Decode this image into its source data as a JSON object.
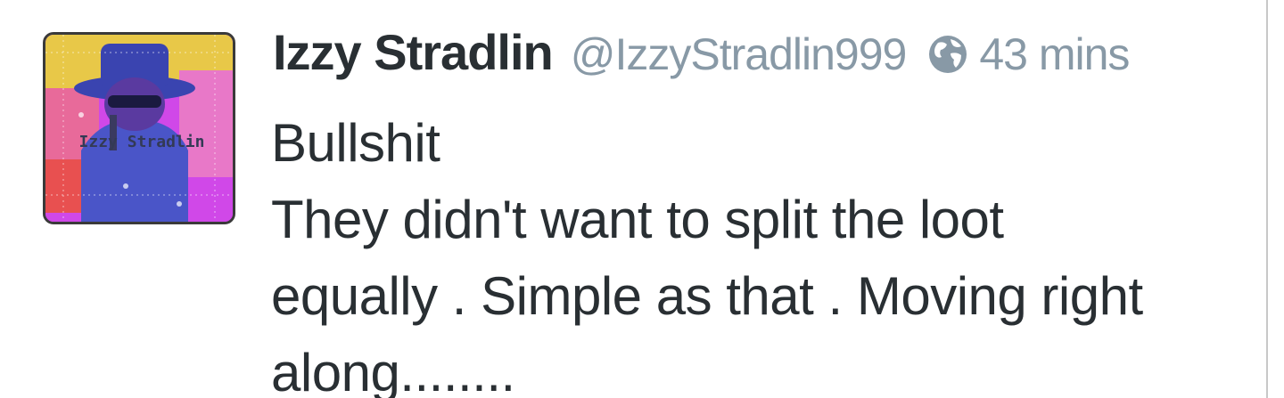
{
  "tweet": {
    "display_name": "Izzy Stradlin",
    "handle": "@IzzyStradlin999",
    "time": "43 mins",
    "privacy_icon": "globe-icon",
    "text_lines": [
      "Bullshit",
      "They didn't want to split the loot",
      "equally . Simple as that . Moving right",
      "along........"
    ],
    "avatar": {
      "caption": "Izzy Stradlin",
      "icon": "avatar-image"
    }
  },
  "colors": {
    "name": "#292f33",
    "meta": "#8899a6",
    "avatar_pink": "#d048e8",
    "avatar_blue": "#4a55c8"
  }
}
